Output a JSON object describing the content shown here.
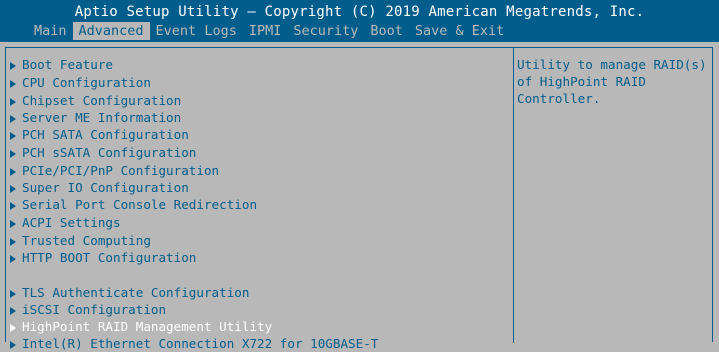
{
  "header": {
    "title": "Aptio Setup Utility – Copyright (C) 2019 American Megatrends, Inc.",
    "tabs": [
      {
        "label": "Main",
        "active": false
      },
      {
        "label": "Advanced",
        "active": true
      },
      {
        "label": "Event Logs",
        "active": false
      },
      {
        "label": "IPMI",
        "active": false
      },
      {
        "label": "Security",
        "active": false
      },
      {
        "label": "Boot",
        "active": false
      },
      {
        "label": "Save & Exit",
        "active": false
      }
    ]
  },
  "menu": {
    "items": [
      {
        "label": "Boot Feature"
      },
      {
        "label": "CPU Configuration"
      },
      {
        "label": "Chipset Configuration"
      },
      {
        "label": "Server ME Information"
      },
      {
        "label": "PCH SATA Configuration"
      },
      {
        "label": "PCH sSATA Configuration"
      },
      {
        "label": "PCIe/PCI/PnP Configuration"
      },
      {
        "label": "Super IO Configuration"
      },
      {
        "label": "Serial Port Console Redirection"
      },
      {
        "label": "ACPI Settings"
      },
      {
        "label": "Trusted Computing"
      },
      {
        "label": "HTTP BOOT Configuration"
      },
      {
        "label": "TLS Authenticate Configuration"
      },
      {
        "label": "iSCSI Configuration"
      },
      {
        "label": "HighPoint RAID Management Utility",
        "selected": true
      },
      {
        "label": "Intel(R) Ethernet Connection X722 for 10GBASE-T"
      }
    ]
  },
  "help": {
    "lines": [
      "Utility to manage RAID(s)",
      "of HighPoint RAID",
      "Controller."
    ]
  },
  "colors": {
    "header_bg": "#005d8c",
    "panel_bg": "#b8b8b8",
    "text": "#005d8c",
    "selected_text": "#ffffff",
    "inactive_tab": "#b9b9b9"
  }
}
